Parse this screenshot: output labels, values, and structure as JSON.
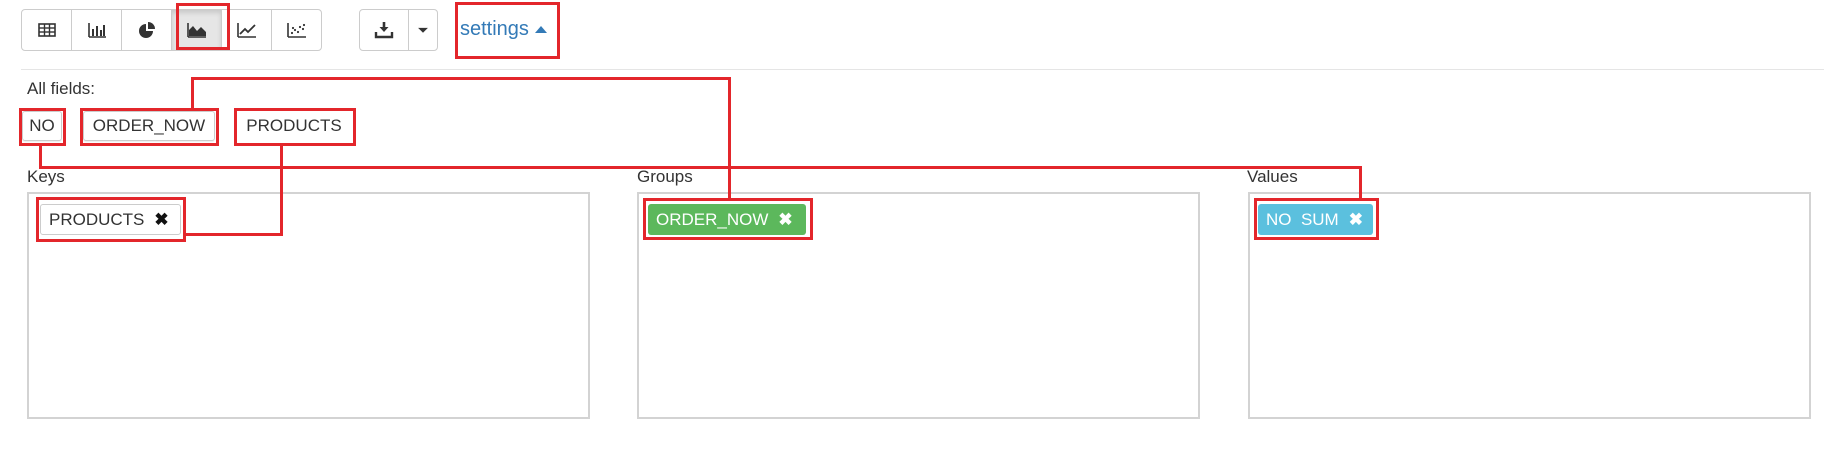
{
  "toolbar": {
    "view_buttons": [
      {
        "name": "table-view-button",
        "icon": "table-icon"
      },
      {
        "name": "bar-chart-button",
        "icon": "bar-chart-icon"
      },
      {
        "name": "pie-chart-button",
        "icon": "pie-chart-icon"
      },
      {
        "name": "area-chart-button",
        "icon": "area-chart-icon",
        "active": true
      },
      {
        "name": "line-chart-button",
        "icon": "line-chart-icon"
      },
      {
        "name": "scatter-chart-button",
        "icon": "scatter-chart-icon"
      }
    ],
    "download_icon": "download-icon",
    "dropdown_icon": "caret-down-icon",
    "settings_label": "settings"
  },
  "fields": {
    "label": "All fields:",
    "items": [
      "NO",
      "ORDER_NOW",
      "PRODUCTS"
    ]
  },
  "keys": {
    "label": "Keys",
    "items": [
      {
        "text": "PRODUCTS"
      }
    ]
  },
  "groups": {
    "label": "Groups",
    "items": [
      {
        "text": "ORDER_NOW",
        "color": "#5cb85c"
      }
    ]
  },
  "values": {
    "label": "Values",
    "items": [
      {
        "text": "NO  SUM",
        "color": "#5bc0de"
      }
    ]
  },
  "colors": {
    "annotation": "#e3262b",
    "link": "#337ab7"
  }
}
